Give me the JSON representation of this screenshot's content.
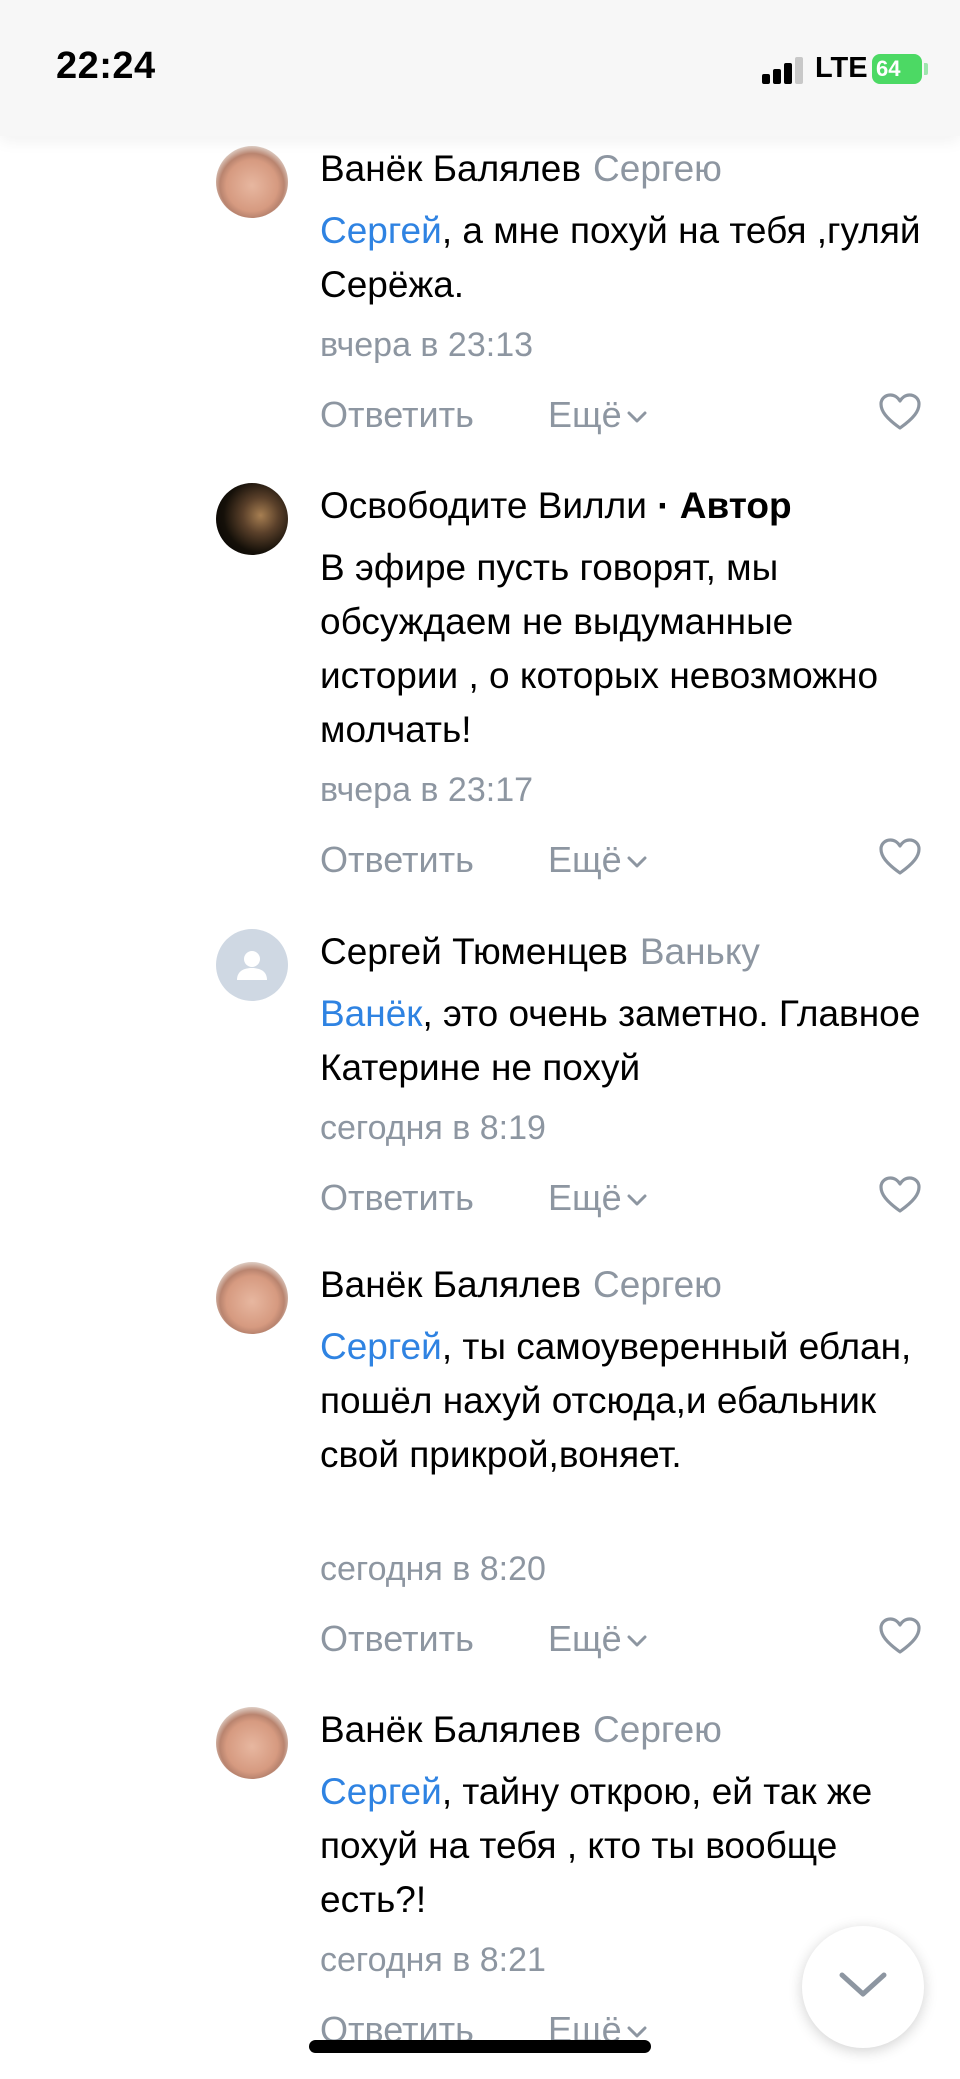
{
  "status_bar": {
    "time": "22:24",
    "network": "LTE",
    "battery": "64"
  },
  "comments": [
    {
      "author": "Ванёк Балялев",
      "reply_to": "Сергею",
      "tag": "",
      "mention": "Сергей",
      "text": ", а мне похуй на тебя ,гуляй Серёжа.",
      "time": "вчера в 23:13"
    },
    {
      "author": "Освободите Вилли",
      "reply_to": "",
      "tag": "· Автор",
      "mention": "",
      "text": "В эфире пусть говорят, мы обсуждаем не выдуманные истории , о которых невозможно молчать!",
      "time": "вчера в 23:17"
    },
    {
      "author": "Сергей Тюменцев",
      "reply_to": "Ваньку",
      "tag": "",
      "mention": "Ванёк",
      "text": ", это очень заметно. Главное Катерине не похуй",
      "time": "сегодня в 8:19"
    },
    {
      "author": "Ванёк Балялев",
      "reply_to": "Сергею",
      "tag": "",
      "mention": "Сергей",
      "text": ", ты самоуверенный еблан, пошёл нахуй отсюда,и ебальник свой прикрой,воняет.",
      "time": "сегодня в 8:20"
    },
    {
      "author": "Ванёк Балялев",
      "reply_to": "Сергею",
      "tag": "",
      "mention": "Сергей",
      "text": ", тайну открою, ей так же похуй на тебя , кто ты вообще есть?!",
      "time": "сегодня в 8:21"
    }
  ],
  "actions": {
    "reply": "Ответить",
    "more": "Ещё"
  },
  "colors": {
    "accent": "#2f83e2",
    "secondary_text": "#8d96a1",
    "battery": "#4cd964"
  },
  "icons": {
    "like": "heart-outline-icon",
    "more": "chevron-down-icon",
    "scroll": "chevron-down-icon"
  }
}
